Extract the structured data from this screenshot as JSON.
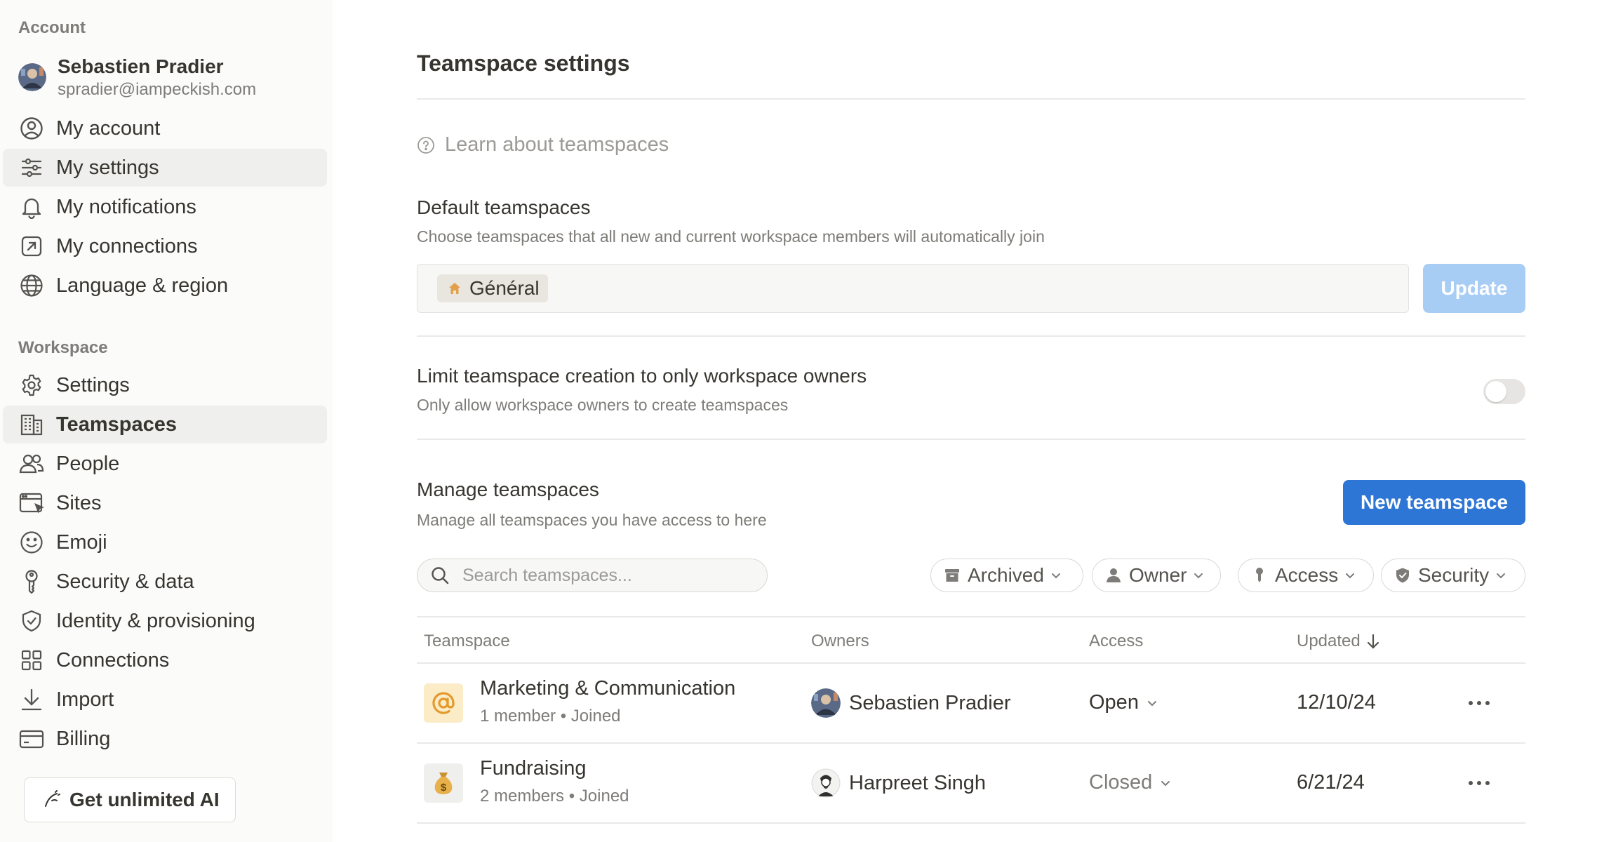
{
  "sidebar": {
    "account_label": "Account",
    "user": {
      "name": "Sebastien Pradier",
      "email": "spradier@iampeckish.com"
    },
    "account_items": [
      {
        "label": "My account",
        "icon": "user-circle-icon"
      },
      {
        "label": "My settings",
        "icon": "sliders-icon",
        "active": true
      },
      {
        "label": "My notifications",
        "icon": "bell-icon"
      },
      {
        "label": "My connections",
        "icon": "arrow-box-icon"
      },
      {
        "label": "Language & region",
        "icon": "globe-icon"
      }
    ],
    "workspace_label": "Workspace",
    "workspace_items": [
      {
        "label": "Settings",
        "icon": "gear-icon"
      },
      {
        "label": "Teamspaces",
        "icon": "building-icon",
        "active": true
      },
      {
        "label": "People",
        "icon": "people-icon"
      },
      {
        "label": "Sites",
        "icon": "browser-icon"
      },
      {
        "label": "Emoji",
        "icon": "smiley-icon"
      },
      {
        "label": "Security & data",
        "icon": "key-icon"
      },
      {
        "label": "Identity & provisioning",
        "icon": "shield-check-icon"
      },
      {
        "label": "Connections",
        "icon": "grid-icon"
      },
      {
        "label": "Import",
        "icon": "download-icon"
      },
      {
        "label": "Billing",
        "icon": "credit-card-icon"
      }
    ],
    "ai_button": "Get unlimited AI"
  },
  "main": {
    "title": "Teamspace settings",
    "learn_link": "Learn about teamspaces",
    "default_teamspaces": {
      "title": "Default teamspaces",
      "description": "Choose teamspaces that all new and current workspace members will automatically join",
      "chip": "Général",
      "update_button": "Update"
    },
    "limit_creation": {
      "title": "Limit teamspace creation to only workspace owners",
      "description": "Only allow workspace owners to create teamspaces",
      "enabled": false
    },
    "manage": {
      "title": "Manage teamspaces",
      "description": "Manage all teamspaces you have access to here",
      "new_button": "New teamspace",
      "search_placeholder": "Search teamspaces...",
      "filters": {
        "archived": "Archived",
        "owner": "Owner",
        "access": "Access",
        "security": "Security"
      },
      "columns": {
        "teamspace": "Teamspace",
        "owners": "Owners",
        "access": "Access",
        "updated": "Updated"
      },
      "rows": [
        {
          "name": "Marketing & Communication",
          "members": "1 member",
          "status": "Joined",
          "icon": "at-sign-icon",
          "icon_bg": "#fbecc7",
          "owner": "Sebastien Pradier",
          "access": "Open",
          "access_color": "#37352f",
          "updated": "12/10/24"
        },
        {
          "name": "Fundraising",
          "members": "2 members",
          "status": "Joined",
          "icon": "money-bag-icon",
          "icon_bg": "#efefed",
          "owner": "Harpreet Singh",
          "access": "Closed",
          "access_color": "#7d7c78",
          "updated": "6/21/24"
        }
      ]
    }
  },
  "colors": {
    "accent": "#2e76d5",
    "update_disabled": "#a8cdf5",
    "sidebar_bg": "#fbfbfa",
    "active_item_bg": "#efefed"
  }
}
